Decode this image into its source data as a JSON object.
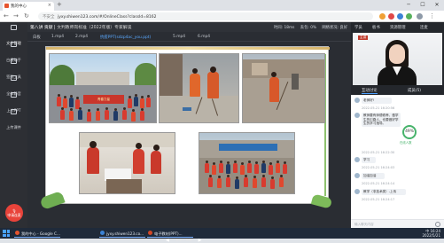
{
  "browser": {
    "tab_title": "我的中心",
    "url": "jyxy.shiwen123.com/#/OnlineClass?classId=8162",
    "security_label": "不安全",
    "new_tab_symbol": "+"
  },
  "app": {
    "breadcrumb_course": "第八讲 贡献",
    "breadcrumb_live": "文判教师岗标准（2022年版）专家解读",
    "stats": [
      "时间: 18ms",
      "丢包: 0%",
      "网络状况: 良好",
      "用户数: 1.0 KB/s",
      "上行: 4.2 KB/s"
    ]
  },
  "sidebar": {
    "items": [
      {
        "label": "文件管理"
      },
      {
        "label": "白板助手"
      },
      {
        "label": "签到工具"
      },
      {
        "label": "全体静音"
      },
      {
        "label": "上传PPT"
      },
      {
        "label": "上传课件"
      }
    ],
    "mic_label": "申请连麦"
  },
  "file_tabs": [
    "白板",
    "1.mp4",
    "2.mp4",
    "抗疫PPT(sdzp4ac_you.ppt)",
    "5.mp4",
    "6.mp4"
  ],
  "slide": {
    "banner_text": "青春力量",
    "current_page": "63",
    "total_pages": "66",
    "page_sep": "/",
    "prev_symbol": "◀",
    "next_symbol": "▶"
  },
  "right_panel": {
    "top_tabs": [
      "学员",
      "板书",
      "资源管理",
      "连麦"
    ],
    "teacher_tag": "主讲",
    "chat_tabs": [
      "互动讨论",
      "成员(5)"
    ],
    "rate_value": "49%",
    "rate_label": "在线人数",
    "messages": [
      {
        "text": "老师好!",
        "time": "2022-05-21 16:20:56"
      },
      {
        "text": "教师要有师德修养，做学生的引路人，也要做好学生的学习指导。",
        "time": "2022-05-21 16:22:30"
      },
      {
        "text": "学习",
        "time": "2022-05-21 16:24:03"
      },
      {
        "text": "加油加油",
        "time": "2022-05-21 16:24:14"
      },
      {
        "text": "教学（非技术类）-上传",
        "time": "2022-05-21 16:24:17"
      }
    ],
    "input_placeholder": "输入聊天内容"
  },
  "taskbar": {
    "apps": [
      "我的中心 - Google C...",
      "jyxy.shiwen123.co...",
      "电子教材(PPT)..."
    ],
    "time": "16:24",
    "date": "2022/5/21",
    "lang": "中"
  }
}
